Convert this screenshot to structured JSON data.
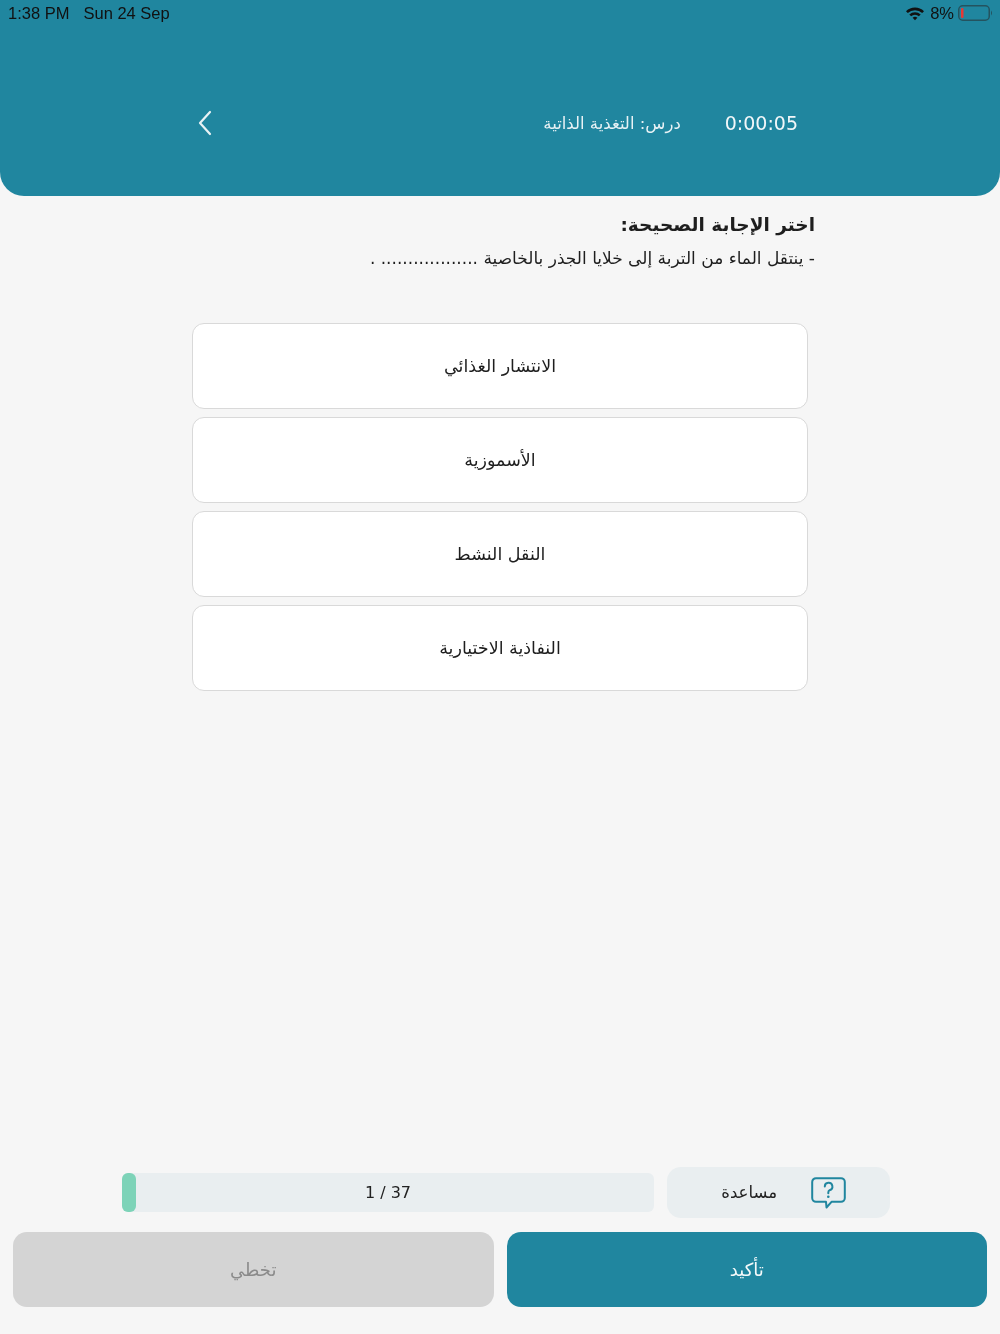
{
  "status_bar": {
    "time": "1:38 PM",
    "date": "Sun 24 Sep",
    "battery": "8%"
  },
  "header": {
    "timer": "0:00:05",
    "lesson_title": "درس: التغذية الذاتية"
  },
  "question": {
    "instruction": "اختر الإجابة الصحيحة:",
    "text": "- ينتقل الماء من التربة إلى خلايا الجذر بالخاصية .................. ."
  },
  "options": [
    {
      "label": "الانتشار الغذائي",
      "selected": false
    },
    {
      "label": "الأسموزية",
      "selected": false
    },
    {
      "label": "النقل النشط",
      "selected": false
    },
    {
      "label": "النفاذية الاختيارية",
      "selected": false
    }
  ],
  "progress": {
    "label": "1 / 37",
    "level": 0.027
  },
  "help_button": {
    "label": "مساعدة"
  },
  "buttons": [
    {
      "kind": "confirm",
      "label": "تأكيد",
      "disabled": false
    },
    {
      "kind": "skip",
      "label": "تخطي",
      "disabled": true
    }
  ]
}
